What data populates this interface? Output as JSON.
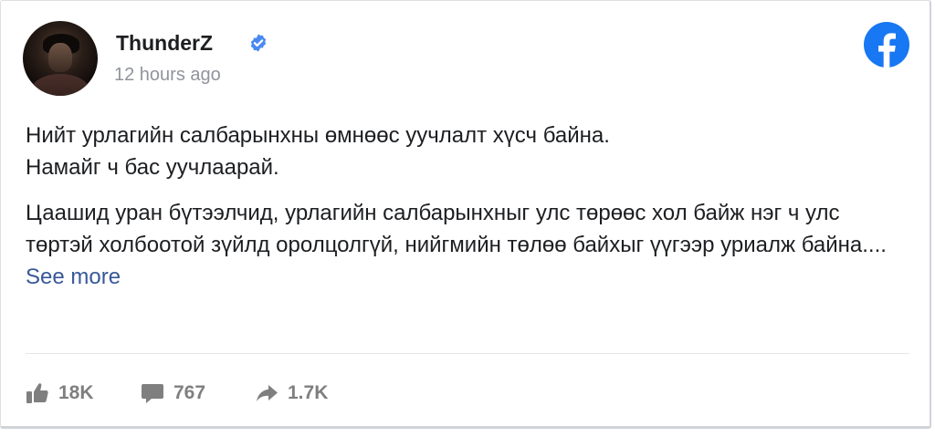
{
  "post": {
    "author": "ThunderZ",
    "verified_icon": "verified-badge-icon",
    "timestamp": "12 hours ago",
    "platform_icon": "facebook-logo-icon",
    "paragraph1_line1": "Нийт урлагийн салбарынхны өмнөөс уучлалт хүсч байна.",
    "paragraph1_line2": "Намайг ч бас уучлаарай.",
    "paragraph2": "Цаашид уран бүтээлчид, урлагийн салбарынхныг улс төрөөс хол байж нэг ч улс төртэй холбоотой зүйлд оролцолгүй, нийгмийн төлөө байхыг үүгээр уриалж байна....",
    "see_more": "See more"
  },
  "stats": {
    "likes": "18K",
    "comments": "767",
    "shares": "1.7K"
  },
  "colors": {
    "facebook_blue": "#1877f2",
    "link": "#385898",
    "muted": "#90949c"
  }
}
